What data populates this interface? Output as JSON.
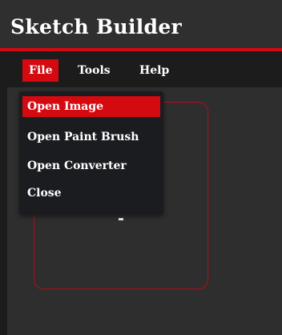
{
  "app": {
    "title": "Sketch Builder"
  },
  "menubar": {
    "items": [
      {
        "label": "File",
        "active": true
      },
      {
        "label": "Tools",
        "active": false
      },
      {
        "label": "Help",
        "active": false
      }
    ]
  },
  "file_menu": {
    "items": [
      {
        "label": "Open Image",
        "highlighted": true
      },
      {
        "label": "Open Paint Brush",
        "highlighted": false
      },
      {
        "label": "Open Converter",
        "highlighted": false
      },
      {
        "label": "Close",
        "highlighted": false
      }
    ]
  },
  "colors": {
    "accent": "#d40a10",
    "titlebar_bg": "#2f2f2f",
    "menubar_bg": "#1c1c1c",
    "canvas_bg": "#2e2e2e",
    "dropdown_bg": "#1b1c20",
    "frame_border": "#b0101a",
    "text": "#ffffff"
  }
}
